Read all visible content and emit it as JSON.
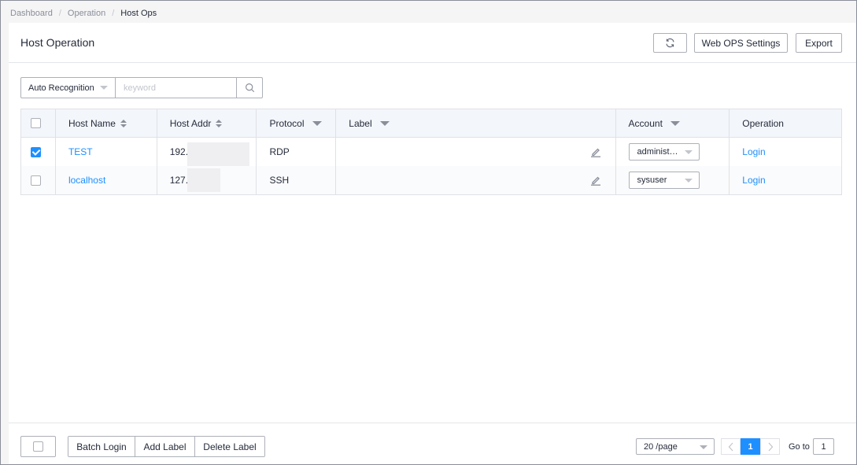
{
  "breadcrumb": {
    "items": [
      "Dashboard",
      "Operation"
    ],
    "current": "Host Ops",
    "separator": "/"
  },
  "header": {
    "title": "Host Operation",
    "web_ops_label": "Web OPS Settings",
    "export_label": "Export"
  },
  "search": {
    "mode": "Auto Recognition",
    "placeholder": "keyword",
    "value": ""
  },
  "table": {
    "columns": {
      "host_name": "Host Name",
      "host_addr": "Host Addr",
      "protocol": "Protocol",
      "label": "Label",
      "account": "Account",
      "operation": "Operation"
    },
    "rows": [
      {
        "checked": true,
        "host_name": "TEST",
        "host_addr": "192.",
        "protocol": "RDP",
        "label": "",
        "account": "administ…",
        "action": "Login"
      },
      {
        "checked": false,
        "host_name": "localhost",
        "host_addr": "127.",
        "protocol": "SSH",
        "label": "",
        "account": "sysuser",
        "action": "Login"
      }
    ]
  },
  "footer": {
    "batch_login": "Batch Login",
    "add_label": "Add Label",
    "delete_label": "Delete Label",
    "page_size": "20 /page",
    "current_page": "1",
    "goto_label": "Go to",
    "goto_value": "1"
  },
  "colors": {
    "accent": "#1e8fff",
    "border": "#adb0b8",
    "header_bg": "#f3f6fb"
  },
  "icons": {
    "refresh": "refresh-icon",
    "search": "search-icon",
    "edit": "edit-icon",
    "prev": "chevron-left-icon",
    "next": "chevron-right-icon"
  }
}
